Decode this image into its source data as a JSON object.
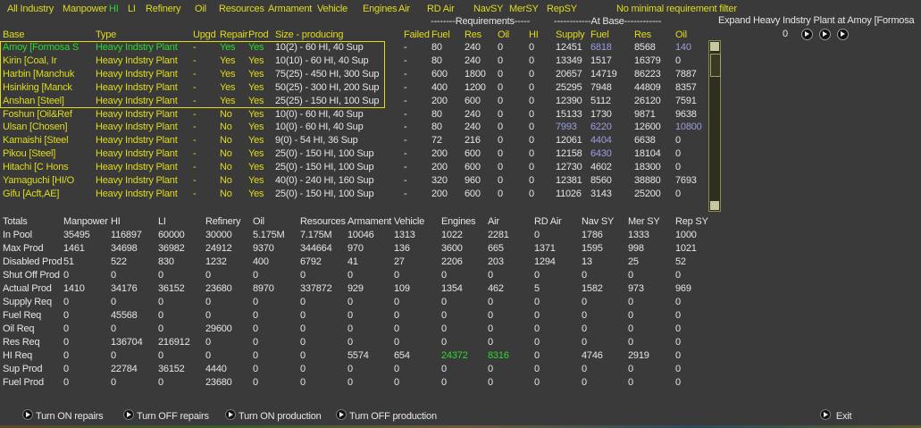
{
  "menu": [
    "All Industry",
    "Manpower",
    "HI",
    "LI",
    "Refinery",
    "Oil",
    "Resources",
    "Armament",
    "Vehicle",
    "Engines",
    "Air",
    "RD Air",
    "NavSY",
    "MerSY",
    "RepSY"
  ],
  "menu_active": "HI",
  "filter_label": "No minimal requirement filter",
  "group_headers": {
    "requirements": "--------Requirements-----",
    "at_base": "------------At Base------------"
  },
  "expand": {
    "label": "Expand Heavy Indstry Plant at Amoy [Formosa",
    "value": "0"
  },
  "columns": [
    "Base",
    "Type",
    "Upgd",
    "Repair",
    "Prod",
    "Size - producing",
    "Failed",
    "Fuel",
    "Res",
    "Oil",
    "HI",
    "Supply",
    "Fuel",
    "Res",
    "Oil"
  ],
  "selected_row": 0,
  "rows": [
    {
      "base": "Amoy [Formosa S",
      "type": "Heavy Indstry Plant",
      "upgd": "-",
      "repair": "Yes",
      "prod": "Yes",
      "size": "10(2) - 60 HI, 40 Sup",
      "failed": "-",
      "req": [
        "80",
        "240",
        "0",
        "0"
      ],
      "at_base": [
        "12451",
        "6818",
        "8568",
        "140"
      ],
      "low": [
        1,
        3
      ]
    },
    {
      "base": "Kirin [Coal, Ir",
      "type": "Heavy Indstry Plant",
      "upgd": "-",
      "repair": "Yes",
      "prod": "Yes",
      "size": "10(10) - 60 HI, 40 Sup",
      "failed": "-",
      "req": [
        "80",
        "240",
        "0",
        "0"
      ],
      "at_base": [
        "13349",
        "1517",
        "16379",
        "0"
      ],
      "low": []
    },
    {
      "base": "Harbin [Manchuk",
      "type": "Heavy Indstry Plant",
      "upgd": "-",
      "repair": "Yes",
      "prod": "Yes",
      "size": "75(25) - 450 HI, 300 Sup",
      "failed": "-",
      "req": [
        "600",
        "1800",
        "0",
        "0"
      ],
      "at_base": [
        "20657",
        "14719",
        "86223",
        "7887"
      ],
      "low": []
    },
    {
      "base": "Hsinking [Manck",
      "type": "Heavy Indstry Plant",
      "upgd": "-",
      "repair": "Yes",
      "prod": "Yes",
      "size": "50(25) - 300 HI, 200 Sup",
      "failed": "-",
      "req": [
        "400",
        "1200",
        "0",
        "0"
      ],
      "at_base": [
        "25295",
        "7948",
        "44809",
        "8357"
      ],
      "low": []
    },
    {
      "base": "Anshan [Steel]",
      "type": "Heavy Indstry Plant",
      "upgd": "-",
      "repair": "Yes",
      "prod": "Yes",
      "size": "25(25) - 150 HI, 100 Sup",
      "failed": "-",
      "req": [
        "200",
        "600",
        "0",
        "0"
      ],
      "at_base": [
        "12390",
        "5112",
        "26120",
        "7591"
      ],
      "low": []
    },
    {
      "base": "Foshun [Oil&Ref",
      "type": "Heavy Indstry Plant",
      "upgd": "-",
      "repair": "No",
      "prod": "Yes",
      "size": "10(0) - 60 HI, 40 Sup",
      "failed": "-",
      "req": [
        "80",
        "240",
        "0",
        "0"
      ],
      "at_base": [
        "15133",
        "1730",
        "9871",
        "9638"
      ],
      "low": []
    },
    {
      "base": "Ulsan [Chosen]",
      "type": "Heavy Indstry Plant",
      "upgd": "-",
      "repair": "No",
      "prod": "Yes",
      "size": "10(0) - 60 HI, 40 Sup",
      "failed": "-",
      "req": [
        "80",
        "240",
        "0",
        "0"
      ],
      "at_base": [
        "7993",
        "6220",
        "12600",
        "10800"
      ],
      "low": [
        0,
        1,
        3
      ]
    },
    {
      "base": "Kamaishi [Steel",
      "type": "Heavy Indstry Plant",
      "upgd": "-",
      "repair": "No",
      "prod": "Yes",
      "size": "9(0) - 54 HI, 36 Sup",
      "failed": "-",
      "req": [
        "72",
        "216",
        "0",
        "0"
      ],
      "at_base": [
        "12061",
        "4404",
        "6638",
        "0"
      ],
      "low": [
        1
      ]
    },
    {
      "base": "Pikou [Steel]",
      "type": "Heavy Indstry Plant",
      "upgd": "-",
      "repair": "No",
      "prod": "Yes",
      "size": "25(0) - 150 HI, 100 Sup",
      "failed": "-",
      "req": [
        "200",
        "600",
        "0",
        "0"
      ],
      "at_base": [
        "12158",
        "6430",
        "18104",
        "0"
      ],
      "low": [
        1
      ]
    },
    {
      "base": "Hitachi [C Hons",
      "type": "Heavy Indstry Plant",
      "upgd": "-",
      "repair": "No",
      "prod": "Yes",
      "size": "25(0) - 150 HI, 100 Sup",
      "failed": "-",
      "req": [
        "200",
        "600",
        "0",
        "0"
      ],
      "at_base": [
        "12730",
        "4602",
        "18300",
        "0"
      ],
      "low": []
    },
    {
      "base": "Yamaguchi [HI/O",
      "type": "Heavy Indstry Plant",
      "upgd": "-",
      "repair": "No",
      "prod": "Yes",
      "size": "40(0) - 240 HI, 160 Sup",
      "failed": "-",
      "req": [
        "320",
        "960",
        "0",
        "0"
      ],
      "at_base": [
        "12381",
        "8560",
        "38880",
        "7693"
      ],
      "low": []
    },
    {
      "base": "Gifu [Acft,AE]",
      "type": "Heavy Indstry Plant",
      "upgd": "-",
      "repair": "No",
      "prod": "Yes",
      "size": "25(0) - 150 HI, 100 Sup",
      "failed": "-",
      "req": [
        "200",
        "600",
        "0",
        "0"
      ],
      "at_base": [
        "11026",
        "3143",
        "25200",
        "0"
      ],
      "low": []
    }
  ],
  "totals": {
    "headers": [
      "Totals",
      "Manpower",
      "HI",
      "LI",
      "Refinery",
      "Oil",
      "Resources",
      "Armament",
      "Vehicle",
      "Engines",
      "Air",
      "RD Air",
      "Nav SY",
      "Mer SY",
      "Rep SY"
    ],
    "rows": [
      {
        "label": "In Pool",
        "values": [
          "35495",
          "116897",
          "60000",
          "30000",
          "5.175M",
          "7.175M",
          "10046",
          "1313",
          "1022",
          "2281",
          "0",
          "1786",
          "1333",
          "1000"
        ]
      },
      {
        "label": "Max Prod",
        "values": [
          "1461",
          "34698",
          "36982",
          "24912",
          "9370",
          "344664",
          "970",
          "136",
          "3600",
          "665",
          "1371",
          "1595",
          "998",
          "1021"
        ]
      },
      {
        "label": "Disabled Prod",
        "values": [
          "51",
          "522",
          "830",
          "1232",
          "400",
          "6792",
          "41",
          "27",
          "2206",
          "203",
          "1294",
          "13",
          "25",
          "52"
        ]
      },
      {
        "label": "Shut Off Prod",
        "values": [
          "0",
          "0",
          "0",
          "0",
          "0",
          "0",
          "0",
          "0",
          "0",
          "0",
          "0",
          "0",
          "0",
          "0"
        ]
      },
      {
        "label": "Actual Prod",
        "values": [
          "1410",
          "34176",
          "36152",
          "23680",
          "8970",
          "337872",
          "929",
          "109",
          "1354",
          "462",
          "5",
          "1582",
          "973",
          "969"
        ]
      },
      {
        "label": "Supply Req",
        "values": [
          "0",
          "0",
          "0",
          "0",
          "0",
          "0",
          "0",
          "0",
          "0",
          "0",
          "0",
          "0",
          "0",
          "0"
        ]
      },
      {
        "label": "Fuel Req",
        "values": [
          "0",
          "45568",
          "0",
          "0",
          "0",
          "0",
          "0",
          "0",
          "0",
          "0",
          "0",
          "0",
          "0",
          "0"
        ]
      },
      {
        "label": "Oil Req",
        "values": [
          "0",
          "0",
          "0",
          "29600",
          "0",
          "0",
          "0",
          "0",
          "0",
          "0",
          "0",
          "0",
          "0",
          "0"
        ]
      },
      {
        "label": "Res Req",
        "values": [
          "0",
          "136704",
          "216912",
          "0",
          "0",
          "0",
          "0",
          "0",
          "0",
          "0",
          "0",
          "0",
          "0",
          "0"
        ]
      },
      {
        "label": "HI Req",
        "values": [
          "0",
          "0",
          "0",
          "0",
          "0",
          "0",
          "5574",
          "654",
          "24372",
          "8316",
          "0",
          "4746",
          "2919",
          "0"
        ],
        "green": [
          8,
          9
        ]
      },
      {
        "label": "Sup Prod",
        "values": [
          "0",
          "22784",
          "36152",
          "4440",
          "0",
          "0",
          "0",
          "0",
          "0",
          "0",
          "0",
          "0",
          "0",
          "0"
        ]
      },
      {
        "label": "Fuel Prod",
        "values": [
          "0",
          "0",
          "0",
          "23680",
          "0",
          "0",
          "0",
          "0",
          "0",
          "0",
          "0",
          "0",
          "0",
          "0"
        ]
      }
    ]
  },
  "actions": [
    "Turn ON repairs",
    "Turn OFF repairs",
    "Turn ON production",
    "Turn OFF production"
  ],
  "exit_label": "Exit",
  "colors": {
    "background": "#3a3a3a",
    "label": "#e0dc1c",
    "value": "#e6e6e6",
    "selected": "#2ed82e",
    "low": "#9c9ce0"
  }
}
